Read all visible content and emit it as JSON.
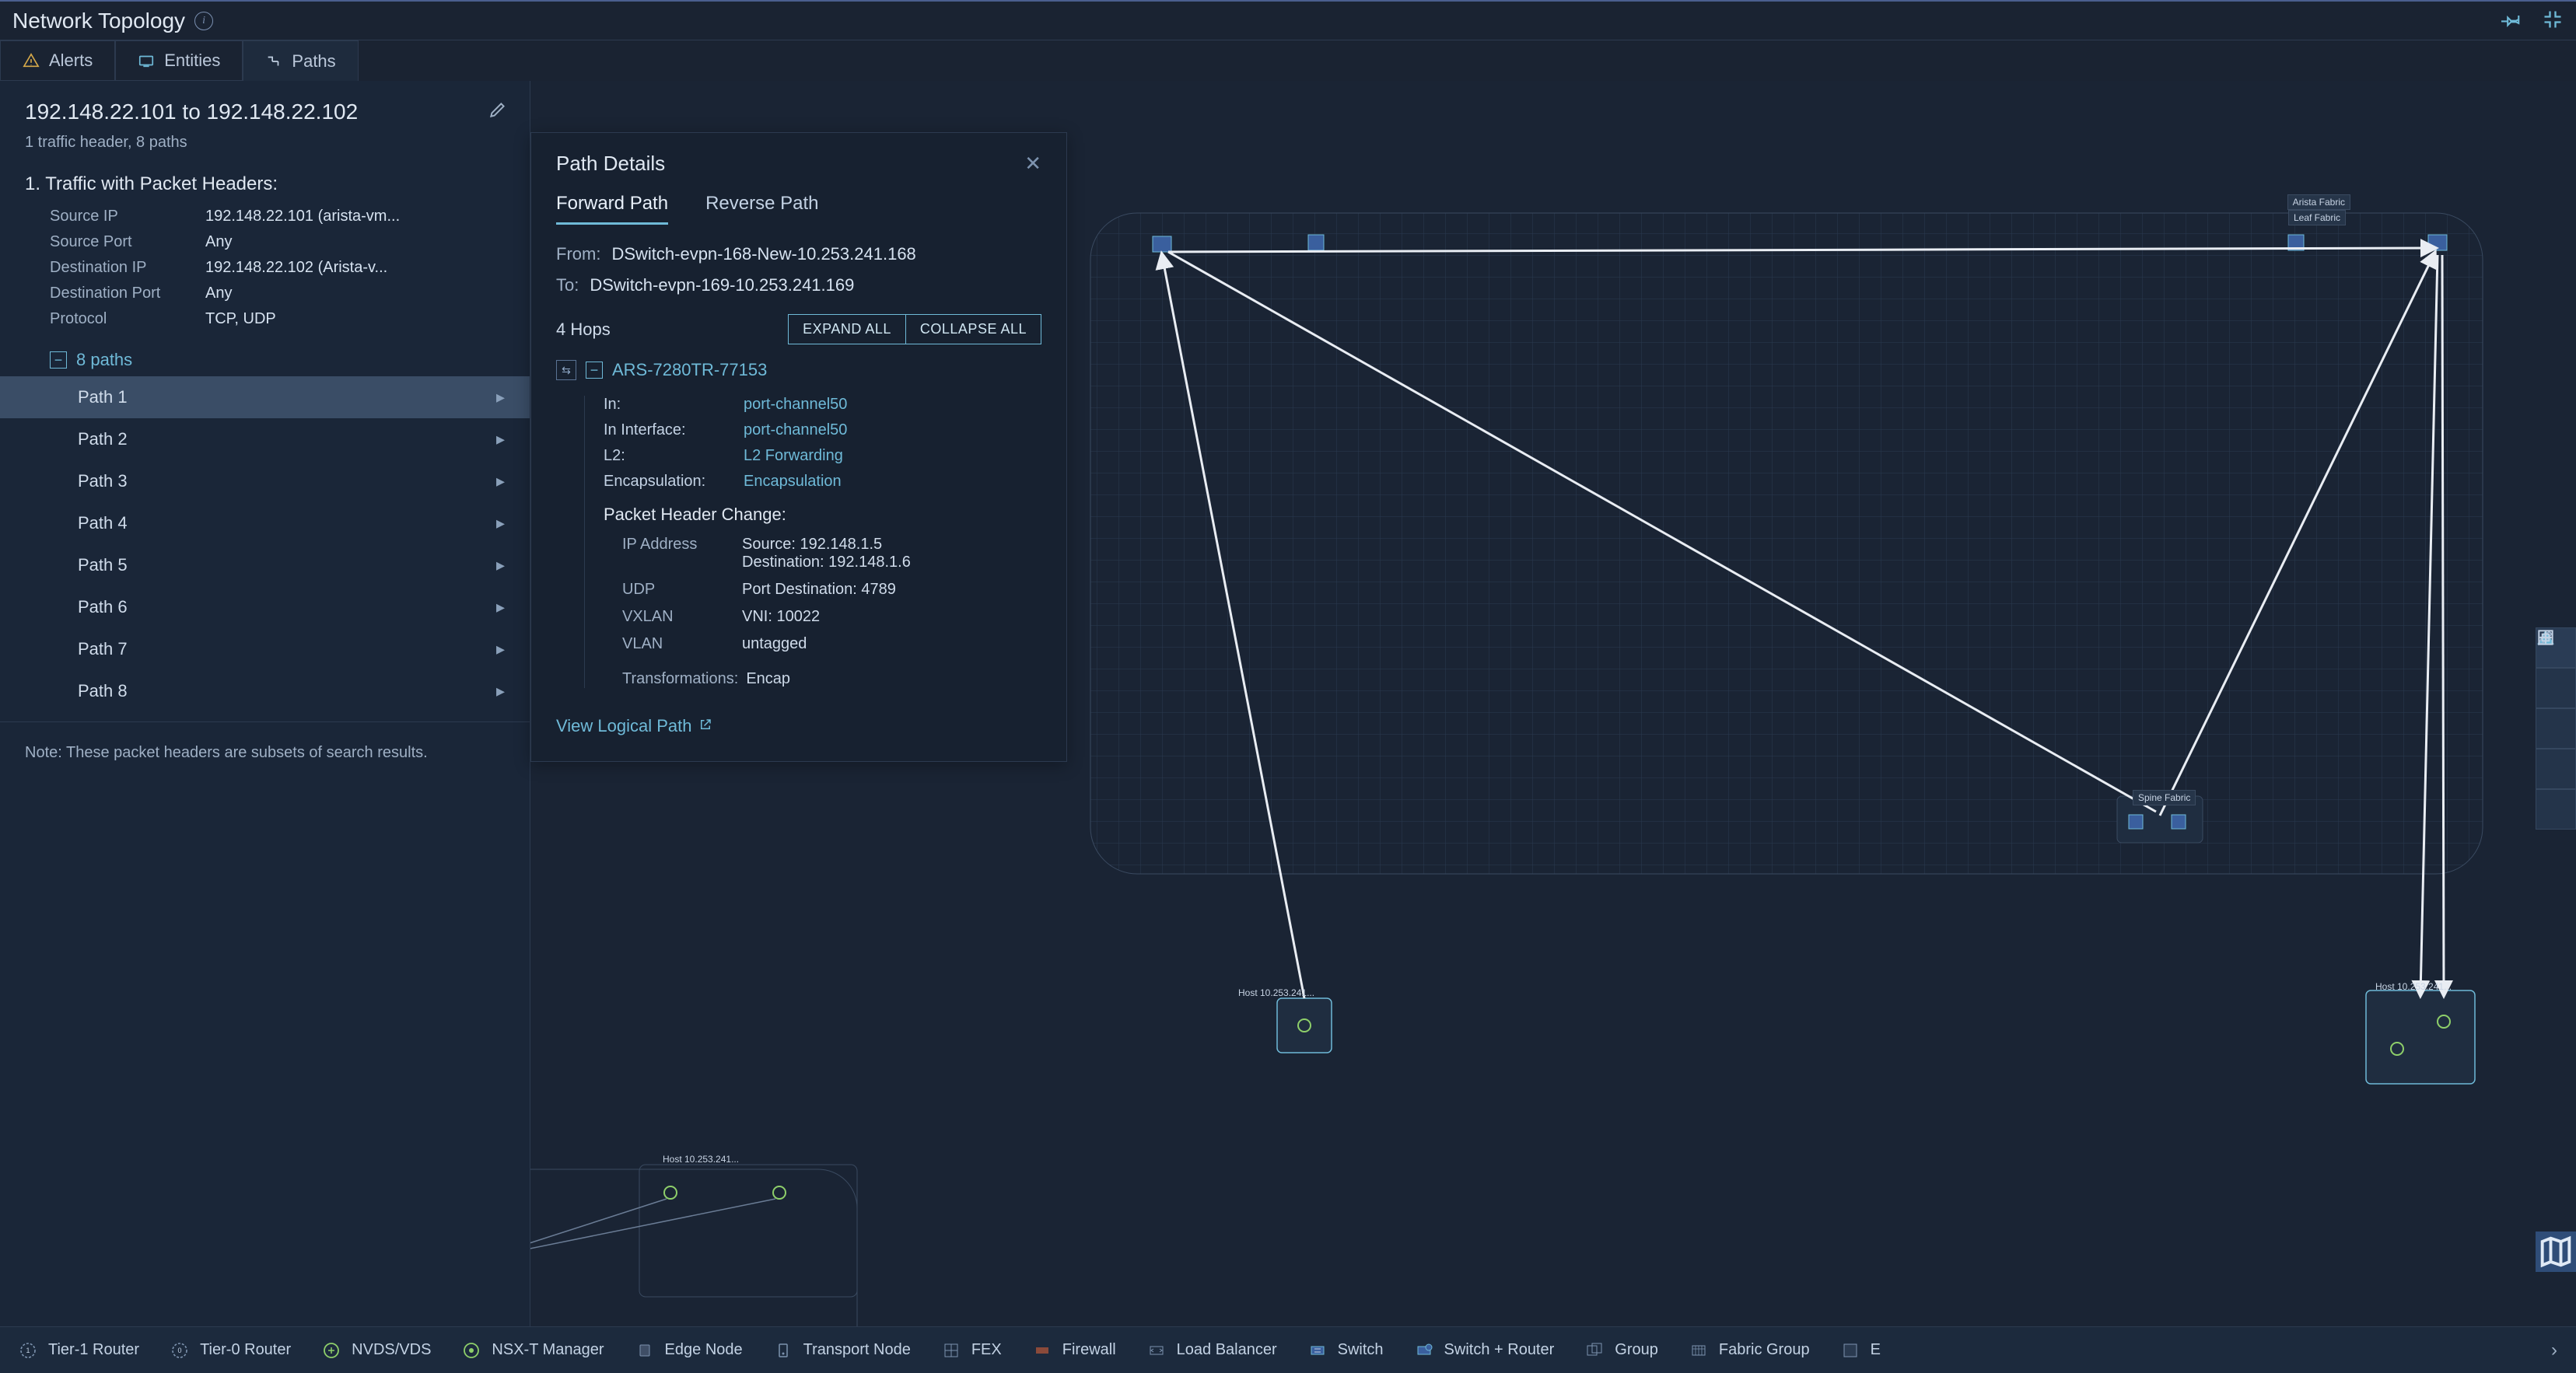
{
  "header": {
    "title": "Network Topology"
  },
  "tabs": {
    "alerts": "Alerts",
    "entities": "Entities",
    "paths": "Paths"
  },
  "query": {
    "title": "192.148.22.101 to 192.148.22.102",
    "summary": "1 traffic header, 8 paths"
  },
  "traffic": {
    "section_title": "1. Traffic with Packet Headers:",
    "fields": {
      "source_ip_k": "Source IP",
      "source_ip_v": "192.148.22.101 (arista-vm...",
      "source_port_k": "Source Port",
      "source_port_v": "Any",
      "dest_ip_k": "Destination IP",
      "dest_ip_v": "192.148.22.102 (Arista-v...",
      "dest_port_k": "Destination Port",
      "dest_port_v": "Any",
      "protocol_k": "Protocol",
      "protocol_v": "TCP, UDP"
    }
  },
  "paths": {
    "count_label": "8 paths",
    "items": [
      "Path 1",
      "Path 2",
      "Path 3",
      "Path 4",
      "Path 5",
      "Path 6",
      "Path 7",
      "Path 8"
    ]
  },
  "note": "Note: These packet headers are subsets of search results.",
  "details": {
    "title": "Path Details",
    "tabs": {
      "forward": "Forward Path",
      "reverse": "Reverse Path"
    },
    "from_k": "From:",
    "from_v": "DSwitch-evpn-168-New-10.253.241.168",
    "to_k": "To:",
    "to_v": "DSwitch-evpn-169-10.253.241.169",
    "hops": "4 Hops",
    "expand": "EXPAND ALL",
    "collapse": "COLLAPSE ALL",
    "device": "ARS-7280TR-77153",
    "hop": {
      "in_k": "In:",
      "in_v": "port-channel50",
      "iniface_k": "In Interface:",
      "iniface_v": "port-channel50",
      "l2_k": "L2:",
      "l2_v": "L2 Forwarding",
      "encap_k": "Encapsulation:",
      "encap_v": "Encapsulation",
      "pkt_title": "Packet Header Change:",
      "ip_k": "IP Address",
      "ip_src": "Source: 192.148.1.5",
      "ip_dst": "Destination: 192.148.1.6",
      "udp_k": "UDP",
      "udp_v": "Port Destination: 4789",
      "vxlan_k": "VXLAN",
      "vxlan_v": "VNI: 10022",
      "vlan_k": "VLAN",
      "vlan_v": "untagged",
      "transf_k": "Transformations:",
      "transf_v": "Encap"
    },
    "logical": "View Logical Path"
  },
  "topology": {
    "arista_fabric": "Arista Fabric",
    "leaf_fabric": "Leaf Fabric",
    "spine_fabric": "Spine Fabric",
    "host1": "Host 10.253.241...",
    "host2": "Host 10.253.241...",
    "host3": "Host 10.253.241..."
  },
  "legend": {
    "items": [
      "Tier-1 Router",
      "Tier-0 Router",
      "NVDS/VDS",
      "NSX-T Manager",
      "Edge Node",
      "Transport Node",
      "FEX",
      "Firewall",
      "Load Balancer",
      "Switch",
      "Switch + Router",
      "Group",
      "Fabric Group"
    ],
    "e": "E"
  }
}
